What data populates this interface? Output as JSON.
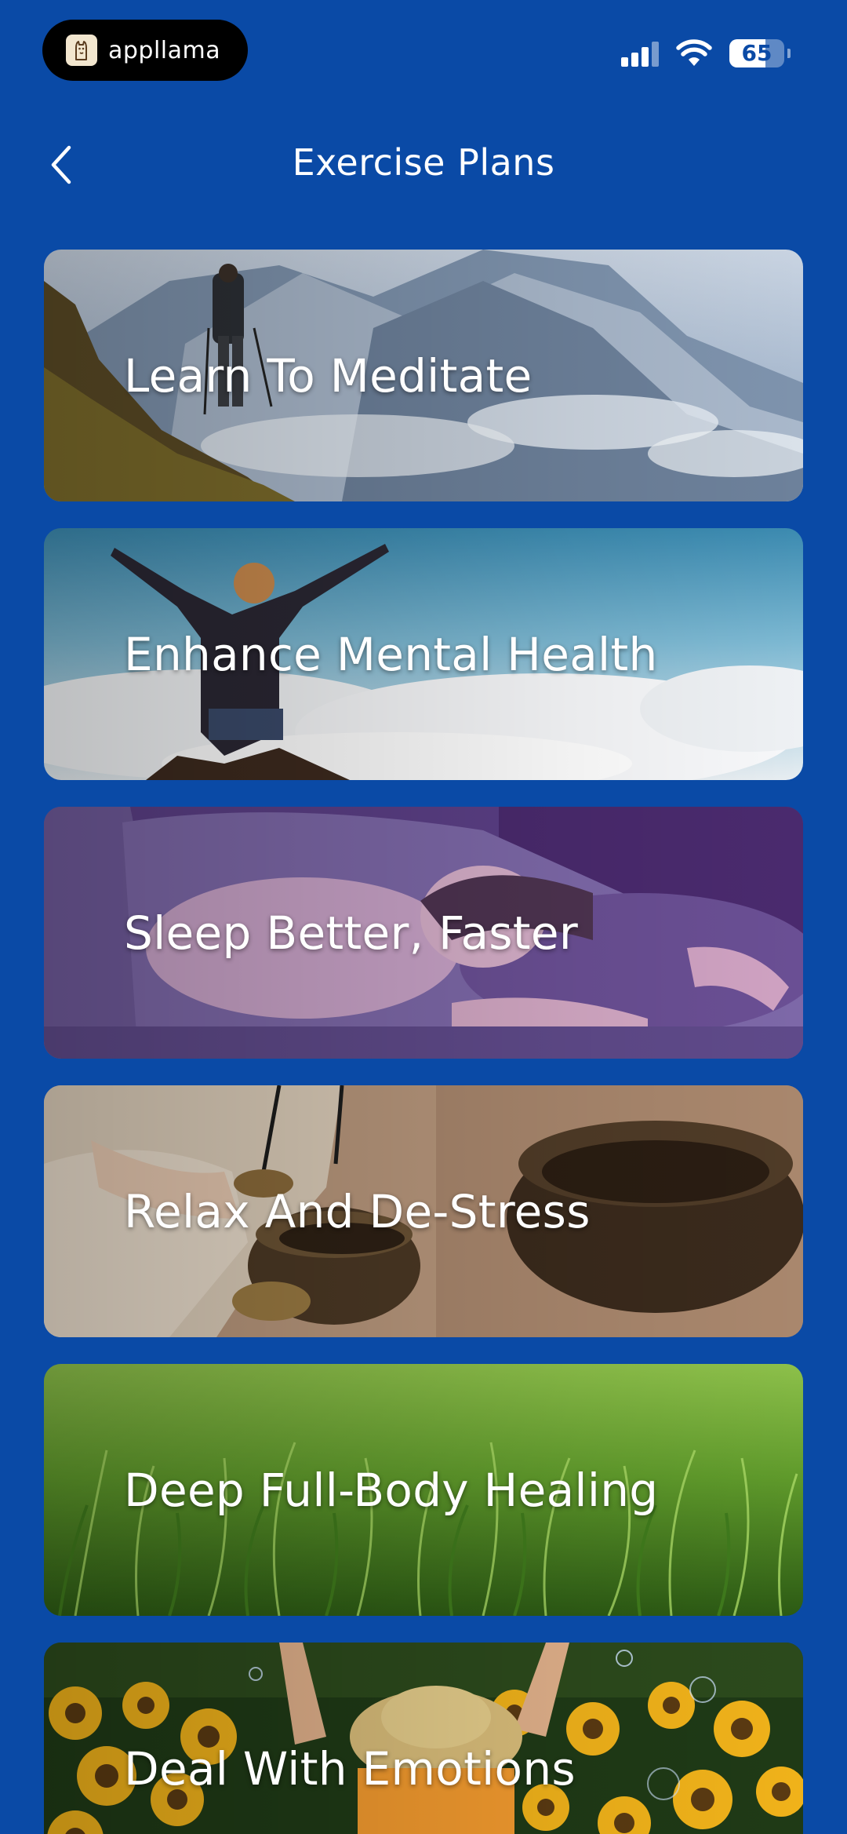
{
  "status_bar": {
    "app_name": "appllama",
    "battery_level": "65",
    "battery_fraction": 0.65,
    "signal_bars_active": 3,
    "signal_bars_total": 4
  },
  "header": {
    "title": "Exercise Plans"
  },
  "plans": [
    {
      "title": "Learn To Meditate",
      "image": "hiker-on-snowy-mountain"
    },
    {
      "title": "Enhance Mental Health",
      "image": "woman-arms-raised-above-clouds"
    },
    {
      "title": "Sleep Better, Faster",
      "image": "woman-sleeping-on-pillow"
    },
    {
      "title": "Relax And De-Stress",
      "image": "singing-bowls-and-chimes"
    },
    {
      "title": "Deep Full-Body Healing",
      "image": "green-grass-field"
    },
    {
      "title": "Deal With Emotions",
      "image": "person-in-sunflower-field"
    }
  ],
  "colors": {
    "background": "#0a4aa6",
    "text": "#ffffff"
  }
}
